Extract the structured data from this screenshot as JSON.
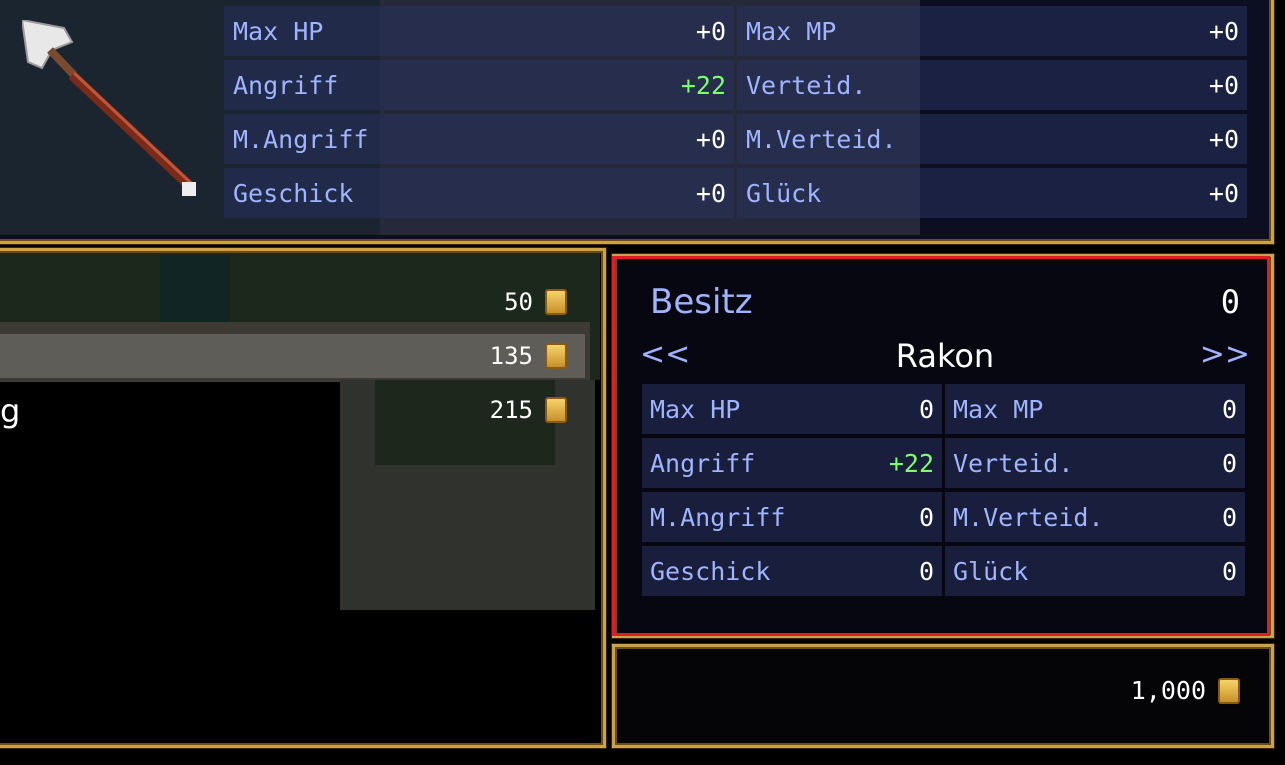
{
  "equip_stats": [
    {
      "label": "Max HP",
      "value": "+0",
      "up": false
    },
    {
      "label": "Max MP",
      "value": "+0",
      "up": false
    },
    {
      "label": "Angriff",
      "value": "+22",
      "up": true
    },
    {
      "label": "Verteid.",
      "value": "+0",
      "up": false
    },
    {
      "label": "M.Angriff",
      "value": "+0",
      "up": false
    },
    {
      "label": "M.Verteid.",
      "value": "+0",
      "up": false
    },
    {
      "label": "Geschick",
      "value": "+0",
      "up": false
    },
    {
      "label": "Glück",
      "value": "+0",
      "up": false
    }
  ],
  "shop_list": {
    "prices": [
      "50",
      "135",
      "215"
    ],
    "selected_index": 1,
    "partial_item_text": "g"
  },
  "status": {
    "possession_label": "Besitz",
    "possession_value": "0",
    "nav_prev": "<<",
    "nav_next": ">>",
    "actor_name": "Rakon",
    "stats": [
      {
        "label": "Max HP",
        "value": "0",
        "up": false
      },
      {
        "label": "Max MP",
        "value": "0",
        "up": false
      },
      {
        "label": "Angriff",
        "value": "+22",
        "up": true
      },
      {
        "label": "Verteid.",
        "value": "0",
        "up": false
      },
      {
        "label": "M.Angriff",
        "value": "0",
        "up": false
      },
      {
        "label": "M.Verteid.",
        "value": "0",
        "up": false
      },
      {
        "label": "Geschick",
        "value": "0",
        "up": false
      },
      {
        "label": "Glück",
        "value": "0",
        "up": false
      }
    ]
  },
  "gold": {
    "amount": "1,000",
    "icon": "gold-coin-icon"
  },
  "colors": {
    "label": "#9fb4ff",
    "increase": "#7dff6a",
    "frame": "#c9a24a",
    "highlight": "#e01c24"
  }
}
